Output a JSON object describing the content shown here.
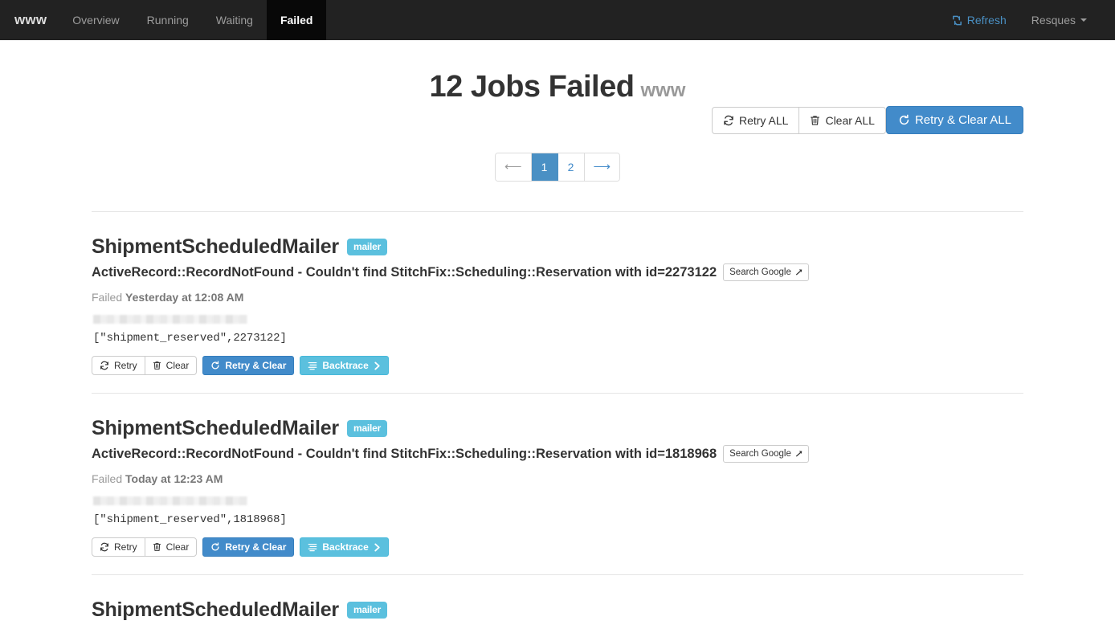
{
  "navbar": {
    "brand": "www",
    "items": [
      {
        "label": "Overview",
        "active": false,
        "name": "overview"
      },
      {
        "label": "Running",
        "active": false,
        "name": "running"
      },
      {
        "label": "Waiting",
        "active": false,
        "name": "waiting"
      },
      {
        "label": "Failed",
        "active": true,
        "name": "failed"
      }
    ],
    "refresh_label": "Refresh",
    "refresh_icon": "refresh-arrows-icon",
    "resques_label": "Resques",
    "resques_caret_icon": "caret-down-icon",
    "bg_color": "#222222",
    "active_bg_color": "#080808",
    "link_color": "#9d9d9d",
    "refresh_color": "#4a90c4"
  },
  "header": {
    "title": "12 Jobs Failed",
    "subtitle": "www",
    "failed_count": 12
  },
  "toolbar": {
    "retry_all_label": "Retry ALL",
    "retry_all_icon": "refresh-icon",
    "clear_all_label": "Clear ALL",
    "clear_all_icon": "trash-icon",
    "retry_clear_all_label": "Retry & Clear ALL",
    "retry_clear_all_icon": "refresh-circle-icon",
    "primary_color": "#428bca"
  },
  "pagination": {
    "prev_icon": "arrow-left-icon",
    "next_icon": "arrow-right-icon",
    "prev_disabled": true,
    "pages": [
      {
        "label": "1",
        "active": true
      },
      {
        "label": "2",
        "active": false
      }
    ],
    "active_color": "#4a90c4"
  },
  "jobs": [
    {
      "title": "ShipmentScheduledMailer",
      "queue_badge": "mailer",
      "error": "ActiveRecord::RecordNotFound - Couldn't find StitchFix::Scheduling::Reservation with id=2273122",
      "search_label": "Search Google",
      "search_icon": "external-link-arrow-icon",
      "failed_prefix": "Failed",
      "failed_when": "Yesterday at 12:08 AM",
      "worker_redacted": true,
      "args": "[\"shipment_reserved\",2273122]",
      "actions": {
        "retry_label": "Retry",
        "retry_icon": "refresh-icon",
        "clear_label": "Clear",
        "clear_icon": "trash-icon",
        "retry_clear_label": "Retry & Clear",
        "retry_clear_icon": "refresh-circle-icon",
        "backtrace_label": "Backtrace",
        "backtrace_icon": "list-icon",
        "backtrace_chevron_icon": "chevron-right-icon"
      }
    },
    {
      "title": "ShipmentScheduledMailer",
      "queue_badge": "mailer",
      "error": "ActiveRecord::RecordNotFound - Couldn't find StitchFix::Scheduling::Reservation with id=1818968",
      "search_label": "Search Google",
      "search_icon": "external-link-arrow-icon",
      "failed_prefix": "Failed",
      "failed_when": "Today at 12:23 AM",
      "worker_redacted": true,
      "args": "[\"shipment_reserved\",1818968]",
      "actions": {
        "retry_label": "Retry",
        "retry_icon": "refresh-icon",
        "clear_label": "Clear",
        "clear_icon": "trash-icon",
        "retry_clear_label": "Retry & Clear",
        "retry_clear_icon": "refresh-circle-icon",
        "backtrace_label": "Backtrace",
        "backtrace_icon": "list-icon",
        "backtrace_chevron_icon": "chevron-right-icon"
      }
    },
    {
      "title": "ShipmentScheduledMailer",
      "queue_badge": "mailer",
      "error": "",
      "search_label": "",
      "search_icon": "external-link-arrow-icon",
      "failed_prefix": "",
      "failed_when": "",
      "worker_redacted": false,
      "args": "",
      "clipped": true
    }
  ],
  "colors": {
    "primary": "#428bca",
    "info": "#5bc0de",
    "badge": "#5bc0de",
    "divider": "#e5e5e5",
    "muted": "#999999"
  }
}
